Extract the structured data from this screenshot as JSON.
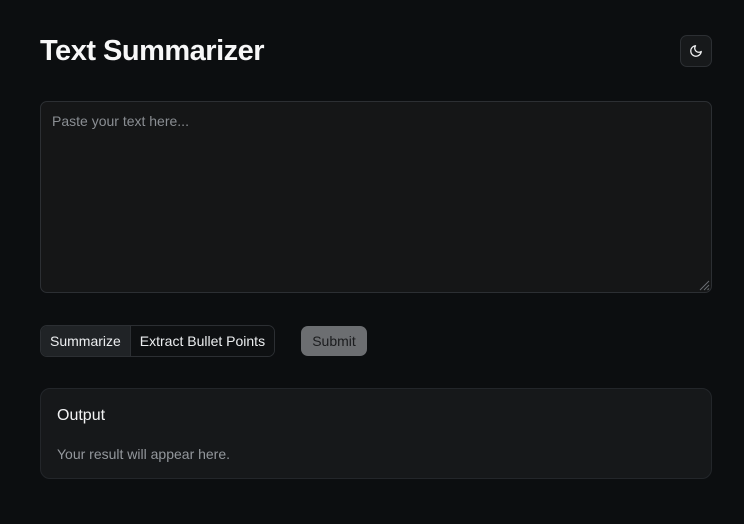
{
  "header": {
    "title": "Text Summarizer",
    "theme_toggle_icon": "moon-icon"
  },
  "input": {
    "placeholder": "Paste your text here...",
    "value": ""
  },
  "mode": {
    "options": [
      "Summarize",
      "Extract Bullet Points"
    ],
    "selected": "Summarize"
  },
  "actions": {
    "submit_label": "Submit"
  },
  "output": {
    "title": "Output",
    "text": "Your result will appear here."
  },
  "colors": {
    "background": "#0c0e10",
    "surface": "#16181a",
    "border": "#2c2f33",
    "submit_disabled": "#6c6e71"
  }
}
